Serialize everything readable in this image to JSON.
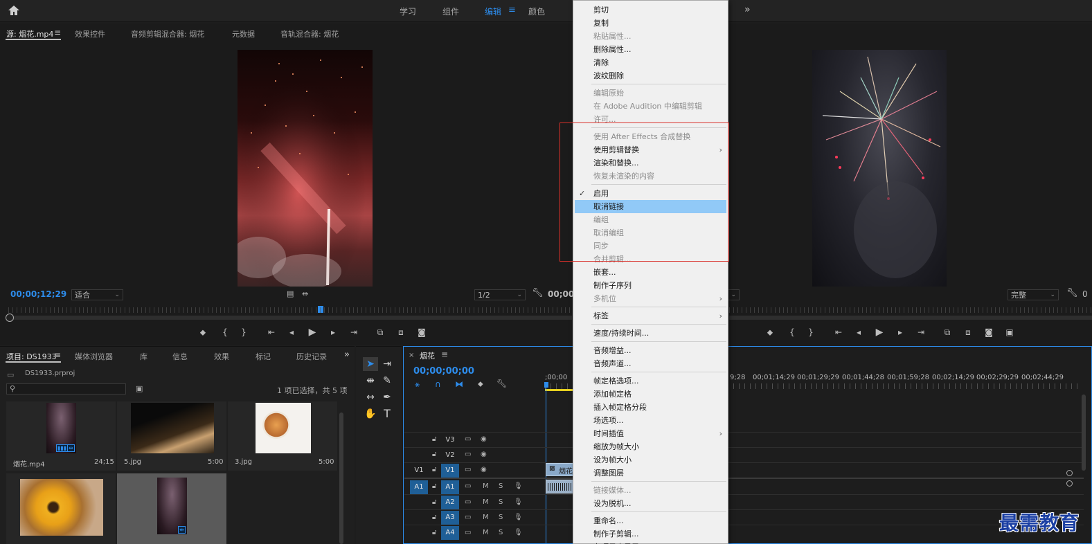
{
  "workspaces": {
    "tabs": [
      {
        "label": "学习"
      },
      {
        "label": "组件"
      },
      {
        "label": "编辑",
        "active": true
      },
      {
        "label": "颜色"
      }
    ],
    "edit_menu_icon": "hamburger-icon",
    "more_icon": "double-chevron-right-icon"
  },
  "source_panel": {
    "tabs": [
      {
        "label": "源: 烟花.mp4",
        "active": true
      },
      {
        "label": "效果控件"
      },
      {
        "label": "音频剪辑混合器: 烟花"
      },
      {
        "label": "元数据"
      },
      {
        "label": "音轨混合器: 烟花"
      }
    ],
    "timecode": "00;00;12;29",
    "fit_dropdown": "适合",
    "resolution_dropdown": "1/2"
  },
  "program_panel": {
    "timecode": "00;00;",
    "quality_dropdown": "完整",
    "timecode_tail": "0"
  },
  "project_panel": {
    "tabs": [
      {
        "label": "项目: DS1933",
        "active": true
      },
      {
        "label": "媒体浏览器"
      },
      {
        "label": "库"
      },
      {
        "label": "信息"
      },
      {
        "label": "效果"
      },
      {
        "label": "标记"
      },
      {
        "label": "历史记录"
      }
    ],
    "project_file": "DS1933.prproj",
    "selection_status": "1 项已选择，共 5 项",
    "items": [
      {
        "name": "烟花.mp4",
        "duration": "24;15"
      },
      {
        "name": "5.jpg",
        "duration": "5:00"
      },
      {
        "name": "3.jpg",
        "duration": "5:00"
      }
    ]
  },
  "timeline": {
    "sequence_name": "烟花",
    "timecode": "00;00;00;00",
    "ruler": [
      ";00;00",
      "9;28",
      "00;01;14;29",
      "00;01;29;29",
      "00;01;44;28",
      "00;01;59;28",
      "00;02;14;29",
      "00;02;29;29",
      "00;02;44;29"
    ],
    "video_tracks": [
      "V3",
      "V2",
      "V1"
    ],
    "audio_tracks": [
      "A1",
      "A2",
      "A3",
      "A4"
    ],
    "source_patch_v": "V1",
    "source_patch_a": "A1",
    "mute_label": "M",
    "solo_label": "S",
    "clip_label": "烟花"
  },
  "context_menu": {
    "items": [
      {
        "label": "剪切"
      },
      {
        "label": "复制"
      },
      {
        "label": "粘贴属性...",
        "disabled": true
      },
      {
        "label": "删除属性..."
      },
      {
        "label": "清除"
      },
      {
        "label": "波纹删除"
      },
      {
        "sep": true
      },
      {
        "label": "编辑原始",
        "disabled": true
      },
      {
        "label": "在 Adobe Audition 中编辑剪辑",
        "disabled": true
      },
      {
        "label": "许可...",
        "disabled": true
      },
      {
        "sep": true
      },
      {
        "label": "使用 After Effects 合成替换",
        "disabled": true
      },
      {
        "label": "使用剪辑替换",
        "submenu": true
      },
      {
        "label": "渲染和替换..."
      },
      {
        "label": "恢复未渲染的内容",
        "disabled": true
      },
      {
        "sep": true
      },
      {
        "label": "启用",
        "checked": true
      },
      {
        "label": "取消链接",
        "highlighted": true
      },
      {
        "label": "编组",
        "disabled": true
      },
      {
        "label": "取消编组",
        "disabled": true
      },
      {
        "label": "同步",
        "disabled": true
      },
      {
        "label": "合并剪辑...",
        "disabled": true
      },
      {
        "label": "嵌套..."
      },
      {
        "label": "制作子序列"
      },
      {
        "label": "多机位",
        "disabled": true,
        "submenu": true
      },
      {
        "sep": true
      },
      {
        "label": "标签",
        "submenu": true
      },
      {
        "sep": true
      },
      {
        "label": "速度/持续时间..."
      },
      {
        "sep": true
      },
      {
        "label": "音频增益..."
      },
      {
        "label": "音频声道..."
      },
      {
        "sep": true
      },
      {
        "label": "帧定格选项..."
      },
      {
        "label": "添加帧定格"
      },
      {
        "label": "插入帧定格分段"
      },
      {
        "label": "场选项..."
      },
      {
        "label": "时间插值",
        "submenu": true
      },
      {
        "label": "缩放为帧大小"
      },
      {
        "label": "设为帧大小"
      },
      {
        "label": "调整图层"
      },
      {
        "sep": true
      },
      {
        "label": "链接媒体...",
        "disabled": true
      },
      {
        "label": "设为脱机..."
      },
      {
        "sep": true
      },
      {
        "label": "重命名..."
      },
      {
        "label": "制作子剪辑..."
      },
      {
        "label": "在项目中显示"
      }
    ],
    "submenu_glyph": "›",
    "check_glyph": "✓"
  },
  "watermark": "最需教育",
  "colors": {
    "accent": "#2d8ceb",
    "menu_highlight": "#91c9f7",
    "annotation_box": "#d9302a"
  }
}
